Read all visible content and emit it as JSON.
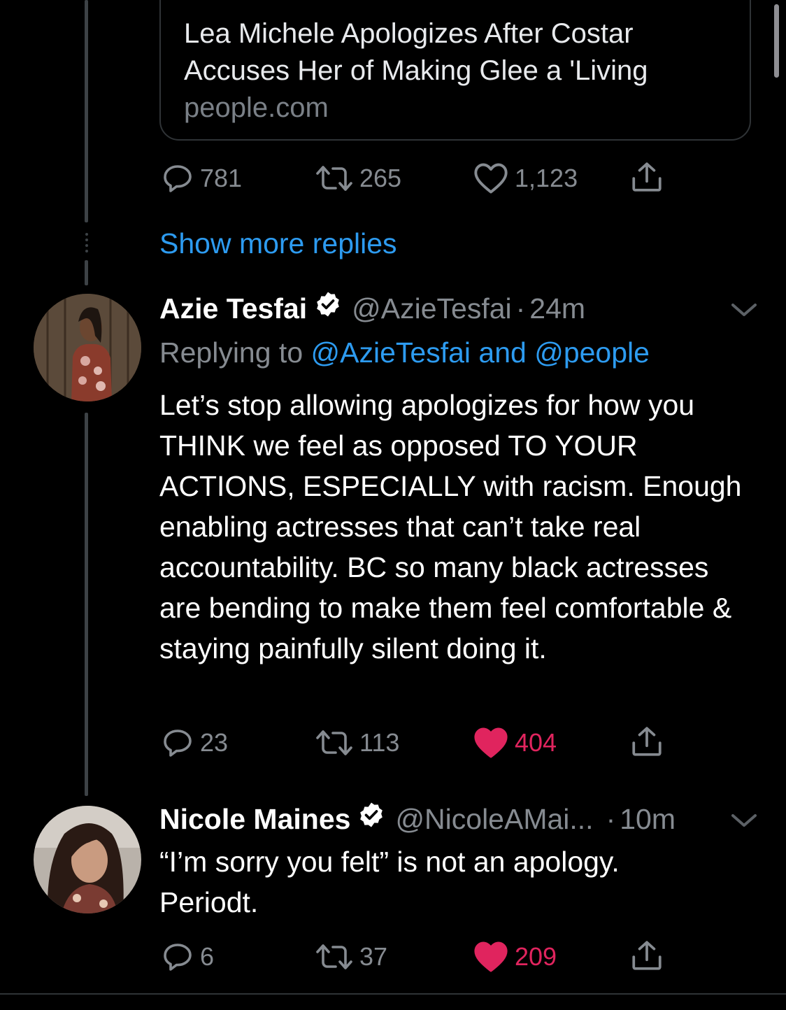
{
  "link_card": {
    "title": "Lea Michele Apologizes After Costar Accuses Her of Making Glee a 'Living",
    "domain": "people.com"
  },
  "first_tweet_actions": {
    "replies": "781",
    "retweets": "265",
    "likes": "1,123"
  },
  "show_more_replies": "Show more replies",
  "tweets": [
    {
      "name": "Azie Tesfai",
      "handle": "@AzieTesfai",
      "separator": "·",
      "time": "24m",
      "replying_label": "Replying to",
      "replying_mentions": "@AzieTesfai and @people",
      "text": "Let’s stop allowing apologizes for how you THINK we feel as opposed TO YOUR ACTIONS, ESPECIALLY with racism. Enough enabling actresses that can’t take real accountability. BC so many black actresses are bending to make them feel comfortable & staying painfully silent doing it.",
      "replies": "23",
      "retweets": "113",
      "likes": "404",
      "liked": true
    },
    {
      "name": "Nicole Maines",
      "handle": "@NicoleAMai...",
      "separator": "·",
      "time": "10m",
      "text": "“I’m sorry you felt” is not an apology. Periodt.",
      "replies": "6",
      "retweets": "37",
      "likes": "209",
      "liked": true
    }
  ],
  "icons": {
    "reply": "reply-icon",
    "retweet": "retweet-icon",
    "like": "heart-icon",
    "share": "share-icon",
    "verified": "verified-badge-icon",
    "more": "chevron-down-icon"
  },
  "colors": {
    "background": "#000000",
    "link": "#2d9bf0",
    "muted": "#868b91",
    "like_active": "#e0245e"
  }
}
